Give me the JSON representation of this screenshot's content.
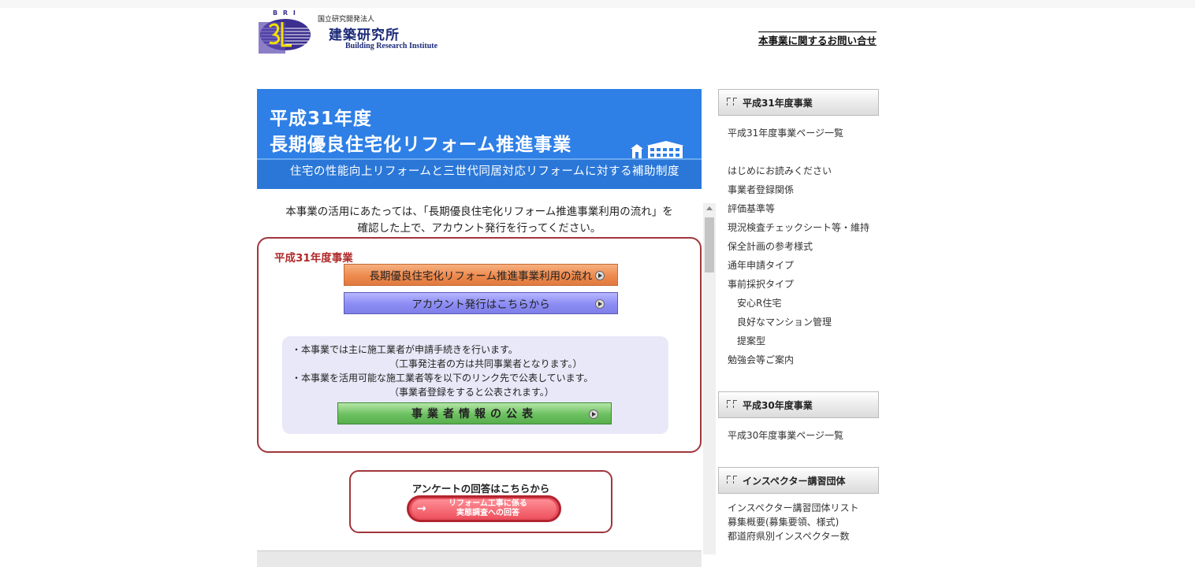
{
  "header": {
    "org_type": "国立研究開発法人",
    "org_name": "建築研究所",
    "org_name_en": "Building Research Institute",
    "logo_letters": "B R I",
    "contact_link": "本事業に関するお問い合せ"
  },
  "banner": {
    "line1": "平成31年度",
    "line2": "長期優良住宅化リフォーム推進事業",
    "subtitle": "住宅の性能向上リフォームと三世代同居対応リフォームに対する補助制度"
  },
  "intro": {
    "line1": "本事業の活用にあたっては、「長期優良住宅化リフォーム推進事業利用の流れ」を",
    "line2": "確認した上で、アカウント発行を行ってください。"
  },
  "h31_box": {
    "title": "平成31年度事業",
    "flow_button": "長期優良住宅化リフォーム推進事業利用の流れ",
    "account_button": "アカウント発行はこちらから",
    "info": {
      "line1": "・本事業では主に施工業者が申請手続きを行います。",
      "line2": "（工事発注者の方は共同事業者となります。）",
      "line3": "・本事業を活用可能な施工業者等を以下のリンク先で公表しています。",
      "line4": "（事業者登録をすると公表されます。）",
      "public_button": "事業者情報の公表"
    }
  },
  "survey": {
    "title": "アンケートの回答はこちらから",
    "button_line1": "リフォーム工事に係る",
    "button_line2": "実態調査への回答"
  },
  "sidebar": {
    "sections": [
      {
        "heading": "平成31年度事業",
        "links": [
          {
            "label": "平成31年度事業ページ一覧",
            "sub": false
          }
        ]
      },
      {
        "heading": "",
        "links": [
          {
            "label": "はじめにお読みください",
            "sub": false
          },
          {
            "label": "事業者登録関係",
            "sub": false
          },
          {
            "label": "評価基準等",
            "sub": false
          },
          {
            "label": "現況検査チェックシート等・維持",
            "sub": false
          },
          {
            "label": "保全計画の参考様式",
            "sub": false
          },
          {
            "label": "通年申請タイプ",
            "sub": false
          },
          {
            "label": "事前採択タイプ",
            "sub": false
          },
          {
            "label": "安心R住宅",
            "sub": true
          },
          {
            "label": "良好なマンション管理",
            "sub": true
          },
          {
            "label": "提案型",
            "sub": true
          },
          {
            "label": "勉強会等ご案内",
            "sub": false
          }
        ]
      },
      {
        "heading": "平成30年度事業",
        "links": [
          {
            "label": "平成30年度事業ページ一覧",
            "sub": false
          }
        ]
      },
      {
        "heading": "インスペクター講習団体",
        "links": [
          {
            "label": "インスペクター講習団体リスト",
            "sub": false
          },
          {
            "label": "募集概要(募集要領、様式)",
            "sub": false
          },
          {
            "label": "都道府県別インスペクター数",
            "sub": false
          }
        ]
      }
    ]
  },
  "colors": {
    "banner_blue": "#2e7fe6",
    "box_border": "#a1363b",
    "title_red": "#b02a2a",
    "flow_orange": "#ee8a4e",
    "account_purple": "#8c8cf4",
    "public_green": "#6cc060",
    "survey_red": "#e64f5c"
  }
}
